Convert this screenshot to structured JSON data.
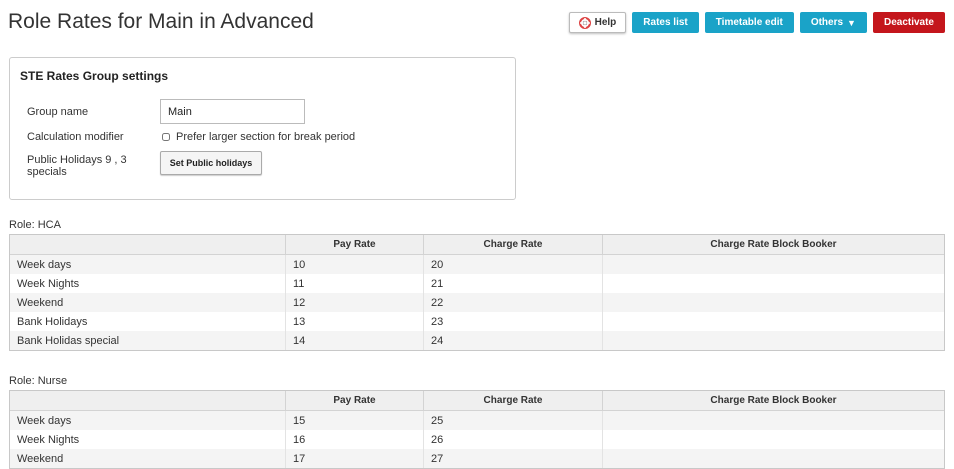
{
  "page": {
    "title": "Role Rates for Main in Advanced"
  },
  "toolbar": {
    "help_label": "Help",
    "rates_list_label": "Rates list",
    "timetable_edit_label": "Timetable edit",
    "others_label": "Others",
    "deactivate_label": "Deactivate"
  },
  "colors": {
    "accent": "#1aa3c8",
    "danger": "#c4161c"
  },
  "settings": {
    "title": "STE Rates Group settings",
    "group_name_label": "Group name",
    "group_name_value": "Main",
    "calc_modifier_label": "Calculation modifier",
    "calc_modifier_checkbox_label": "Prefer larger section for break period",
    "calc_modifier_checked": false,
    "public_holidays_label_line1": "Public Holidays 9 , 3",
    "public_holidays_label_line2": "specials",
    "set_public_holidays_label": "Set Public holidays"
  },
  "columns": [
    "",
    "Pay Rate",
    "Charge Rate",
    "Charge Rate Block Booker"
  ],
  "roles": [
    {
      "label": "Role: HCA",
      "rows": [
        {
          "name": "Week days",
          "pay": "10",
          "charge": "20",
          "block": ""
        },
        {
          "name": "Week Nights",
          "pay": "11",
          "charge": "21",
          "block": ""
        },
        {
          "name": "Weekend",
          "pay": "12",
          "charge": "22",
          "block": ""
        },
        {
          "name": "Bank Holidays",
          "pay": "13",
          "charge": "23",
          "block": ""
        },
        {
          "name": "Bank Holidas special",
          "pay": "14",
          "charge": "24",
          "block": ""
        }
      ]
    },
    {
      "label": "Role: Nurse",
      "rows": [
        {
          "name": "Week days",
          "pay": "15",
          "charge": "25",
          "block": ""
        },
        {
          "name": "Week Nights",
          "pay": "16",
          "charge": "26",
          "block": ""
        },
        {
          "name": "Weekend",
          "pay": "17",
          "charge": "27",
          "block": ""
        }
      ]
    }
  ]
}
